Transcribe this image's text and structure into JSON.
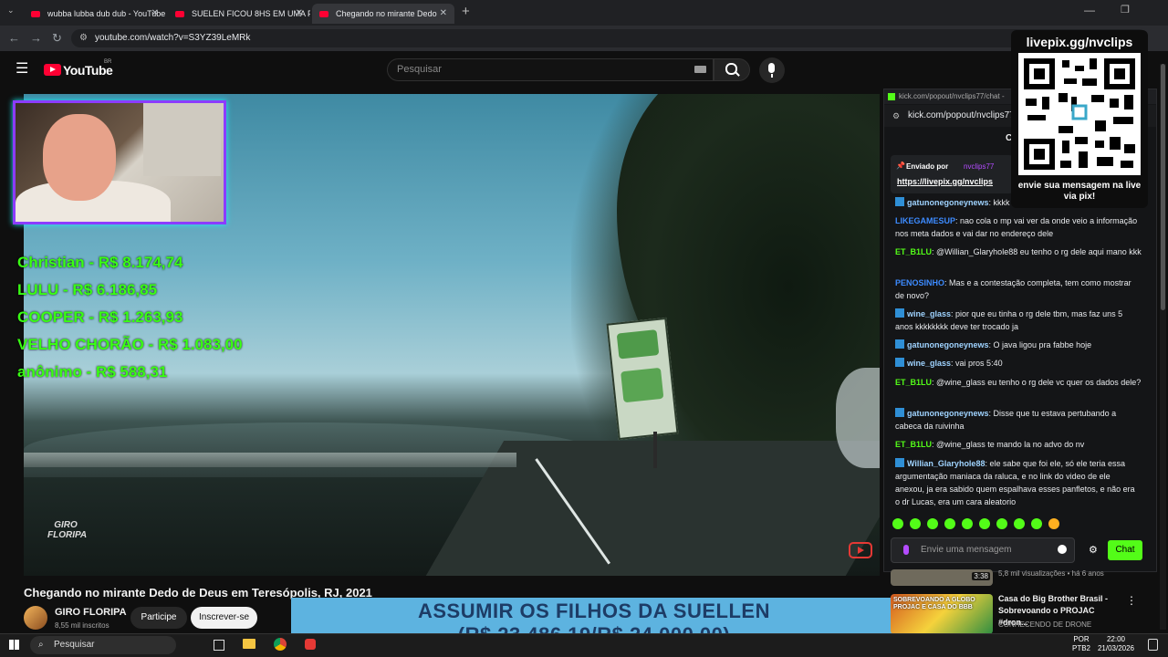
{
  "browser": {
    "tabs": [
      {
        "title": "wubba lubba dub dub - YouTube"
      },
      {
        "title": "SUELEN FICOU 8HS EM UMA PI"
      },
      {
        "title": "Chegando no mirante Dedo"
      }
    ],
    "url": "youtube.com/watch?v=S3YZ39LeMRk"
  },
  "youtube": {
    "logo": "YouTube",
    "region": "BR",
    "search_placeholder": "Pesquisar"
  },
  "overlay": {
    "donors": [
      "Christian - R$ 8.174,74",
      "LULU - R$ 6.186,85",
      "COOPER - R$ 1.263,93",
      "VELHO CHORÃO - R$ 1.083,00",
      "anônimo - R$ 588,31"
    ],
    "channel_watermark_1": "GIRO",
    "channel_watermark_2": "FLORIPA",
    "qr_title": "livepix.gg/nvclips",
    "qr_caption": "envie sua mensagem na live via pix!",
    "goal_line1": "ASSUMIR OS FILHOS DA SUELLEN",
    "goal_line2": "(R$ 23.486,19/R$ 24.000,00)",
    "goal_current": 23486.19,
    "goal_target": 24000
  },
  "video": {
    "title": "Chegando no mirante Dedo de Deus em Teresópolis, RJ, 2021",
    "channel": "GIRO FLORIPA",
    "subscribers": "8,55 mil inscritos",
    "join_label": "Participe",
    "subscribe_label": "Inscrever-se"
  },
  "chat": {
    "window_title": "kick.com/popout/nvclips77/chat -",
    "url": "kick.com/popout/nvclips77/",
    "header_letter": "C",
    "pinned_by": "Enviado por",
    "pinned_user": "nvclips77",
    "pinned_link": "https://livepix.gg/nvclips",
    "messages": [
      {
        "user": "gatunonegoneynews",
        "text": " kkkk",
        "color": "#9fd3ff"
      },
      {
        "user": "LIKEGAMESUP",
        "text": " nao cola o mp vai ver da onde veio a informação nos meta dados e vai dar no endereço dele",
        "color": "#3d8bff"
      },
      {
        "user": "ET_B1LU",
        "text": " @Willian_Glaryhole88 eu tenho o rg dele aqui mano kkk",
        "color": "#53fc18"
      },
      {
        "user": "PENOSINHO",
        "text": " Mas e a contestação completa, tem como mostrar de novo?",
        "color": "#3d8bff"
      },
      {
        "user": "wine_glass",
        "text": " pior que eu tinha o rg dele tbm, mas faz uns 5 anos kkkkkkkk deve ter trocado ja",
        "color": "#9fd3ff"
      },
      {
        "user": "gatunonegoneynews",
        "text": " O java ligou pra fabbe hoje",
        "color": "#9fd3ff"
      },
      {
        "user": "wine_glass",
        "text": " vai pros 5:40",
        "color": "#9fd3ff"
      },
      {
        "user": "ET_B1LU",
        "text": " @wine_glass eu tenho o rg dele vc quer os dados dele?",
        "color": "#53fc18"
      },
      {
        "user": "gatunonegoneynews",
        "text": " Disse que tu estava pertubando a cabeca da ruivinha",
        "color": "#9fd3ff"
      },
      {
        "user": "ET_B1LU",
        "text": " @wine_glass te mando la no advo do nv",
        "color": "#53fc18"
      },
      {
        "user": "Willian_Glaryhole88",
        "text": " ele sabe que foi ele, só ele teria essa argumentação maniaca da raluca, e no link do video de ele anexou, ja era sabido quem espalhava esses panfletos, e não era o dr Lucas, era um cara aleatorio",
        "color": "#9fd3ff"
      }
    ],
    "input_placeholder": "Envie uma mensagem",
    "send_label": "Chat"
  },
  "recommendations": [
    {
      "views": "5,8 mil visualizações",
      "age": "há 6 anos",
      "duration": "3:38"
    },
    {
      "title": "Casa do Big Brother Brasil - Sobrevoando o PROJAC #dron...",
      "channel": "CONHECENDO DE DRONE",
      "thumb_text": "SOBREVOANDO A GLOBO PROJAC E CASA DO BBB"
    }
  ],
  "taskbar": {
    "search": "Pesquisar",
    "lang1": "POR",
    "lang2": "PTB2",
    "time": "22:00",
    "date": "21/03/2026"
  }
}
